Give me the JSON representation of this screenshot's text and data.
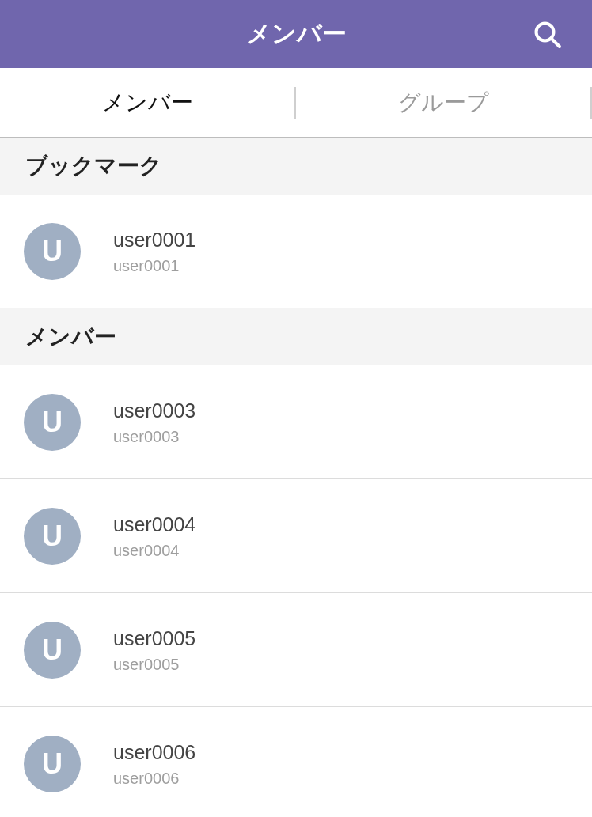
{
  "header": {
    "title": "メンバー"
  },
  "tabs": [
    {
      "label": "メンバー",
      "selected": true
    },
    {
      "label": "グループ",
      "selected": false
    }
  ],
  "sections": [
    {
      "title": "ブックマーク",
      "members": [
        {
          "initial": "U",
          "display_name": "user0001",
          "account": "user0001"
        }
      ]
    },
    {
      "title": "メンバー",
      "members": [
        {
          "initial": "U",
          "display_name": "user0003",
          "account": "user0003"
        },
        {
          "initial": "U",
          "display_name": "user0004",
          "account": "user0004"
        },
        {
          "initial": "U",
          "display_name": "user0005",
          "account": "user0005"
        },
        {
          "initial": "U",
          "display_name": "user0006",
          "account": "user0006"
        }
      ]
    }
  ]
}
